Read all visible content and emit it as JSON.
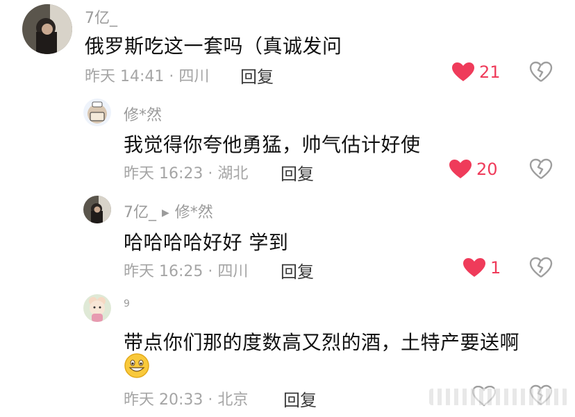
{
  "colors": {
    "like_red": "#ef3b5a",
    "meta_grey": "#a5a5a5",
    "text": "#111111"
  },
  "reply_label": "回复",
  "comments": [
    {
      "user": "7亿_",
      "text": "俄罗斯吃这一套吗（真诚发问",
      "meta": "昨天 14:41 · 四川",
      "likes": "21",
      "liked": true
    },
    {
      "user": "修*然",
      "text": "我觉得你夸他勇猛，帅气估计好使",
      "meta": "昨天 16:23 · 湖北",
      "likes": "20",
      "liked": true
    },
    {
      "user": "7亿_",
      "reply_to": "修*然",
      "text": "哈哈哈哈好好 学到",
      "meta": "昨天 16:25 · 四川",
      "likes": "1",
      "liked": true
    },
    {
      "user": "9",
      "text": "带点你们那的度数高又烈的酒，土特产要送啊",
      "meta": "昨天 20:33 · 北京",
      "likes": "",
      "liked": false,
      "emoji": "grinning-face"
    }
  ]
}
